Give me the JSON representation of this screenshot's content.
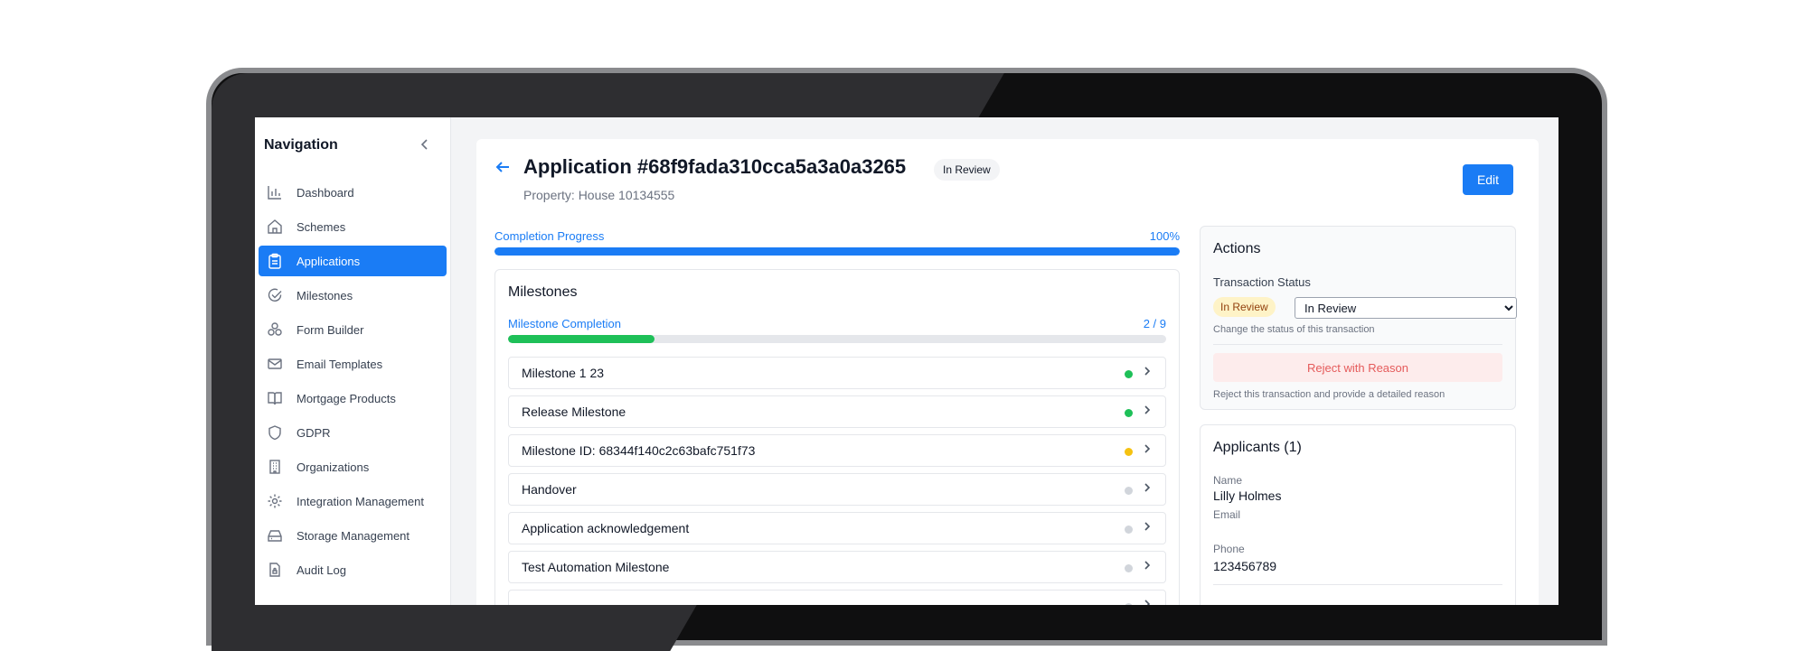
{
  "sidebar": {
    "title": "Navigation",
    "items": [
      {
        "label": "Dashboard",
        "icon": "bar-chart-icon"
      },
      {
        "label": "Schemes",
        "icon": "home-icon"
      },
      {
        "label": "Applications",
        "icon": "clipboard-icon",
        "active": true
      },
      {
        "label": "Milestones",
        "icon": "check-circle-icon"
      },
      {
        "label": "Form Builder",
        "icon": "blocks-icon"
      },
      {
        "label": "Email Templates",
        "icon": "mail-icon"
      },
      {
        "label": "Mortgage Products",
        "icon": "book-icon"
      },
      {
        "label": "GDPR",
        "icon": "shield-icon"
      },
      {
        "label": "Organizations",
        "icon": "building-icon"
      },
      {
        "label": "Integration Management",
        "icon": "gear-icon"
      },
      {
        "label": "Storage Management",
        "icon": "hard-drive-icon"
      },
      {
        "label": "Audit Log",
        "icon": "file-lock-icon"
      }
    ]
  },
  "header": {
    "title": "Application #68f9fada310cca5a3a0a3265",
    "status": "In Review",
    "property": "Property: House 10134555",
    "edit_label": "Edit"
  },
  "completion": {
    "label": "Completion Progress",
    "percent_text": "100%",
    "fraction": 1.0
  },
  "milestones": {
    "title": "Milestones",
    "completion_label": "Milestone Completion",
    "completion_text": "2 / 9",
    "completed": 2,
    "total": 9,
    "items": [
      {
        "label": "Milestone 1 23",
        "status_color": "#1ec058"
      },
      {
        "label": "Release Milestone",
        "status_color": "#1ec058"
      },
      {
        "label": "Milestone ID: 68344f140c2c63bafc751f73",
        "status_color": "#f5c211"
      },
      {
        "label": "Handover",
        "status_color": "#d1d5db"
      },
      {
        "label": "Application acknowledgement",
        "status_color": "#d1d5db"
      },
      {
        "label": "Test Automation Milestone",
        "status_color": "#d1d5db"
      },
      {
        "label": "",
        "status_color": "#d1d5db"
      }
    ]
  },
  "actions": {
    "title": "Actions",
    "transaction_status_label": "Transaction Status",
    "current_status": "In Review",
    "select_value": "In Review",
    "status_help": "Change the status of this transaction",
    "reject_label": "Reject with Reason",
    "reject_help": "Reject this transaction and provide a detailed reason"
  },
  "applicants": {
    "title": "Applicants (1)",
    "name_label": "Name",
    "name_value": "Lilly Holmes",
    "email_label": "Email",
    "phone_label": "Phone",
    "phone_value": "123456789"
  },
  "colors": {
    "accent": "#1a7cf5",
    "success": "#1ec058",
    "warning_bg": "#fef3c7",
    "danger": "#e55b5b"
  }
}
